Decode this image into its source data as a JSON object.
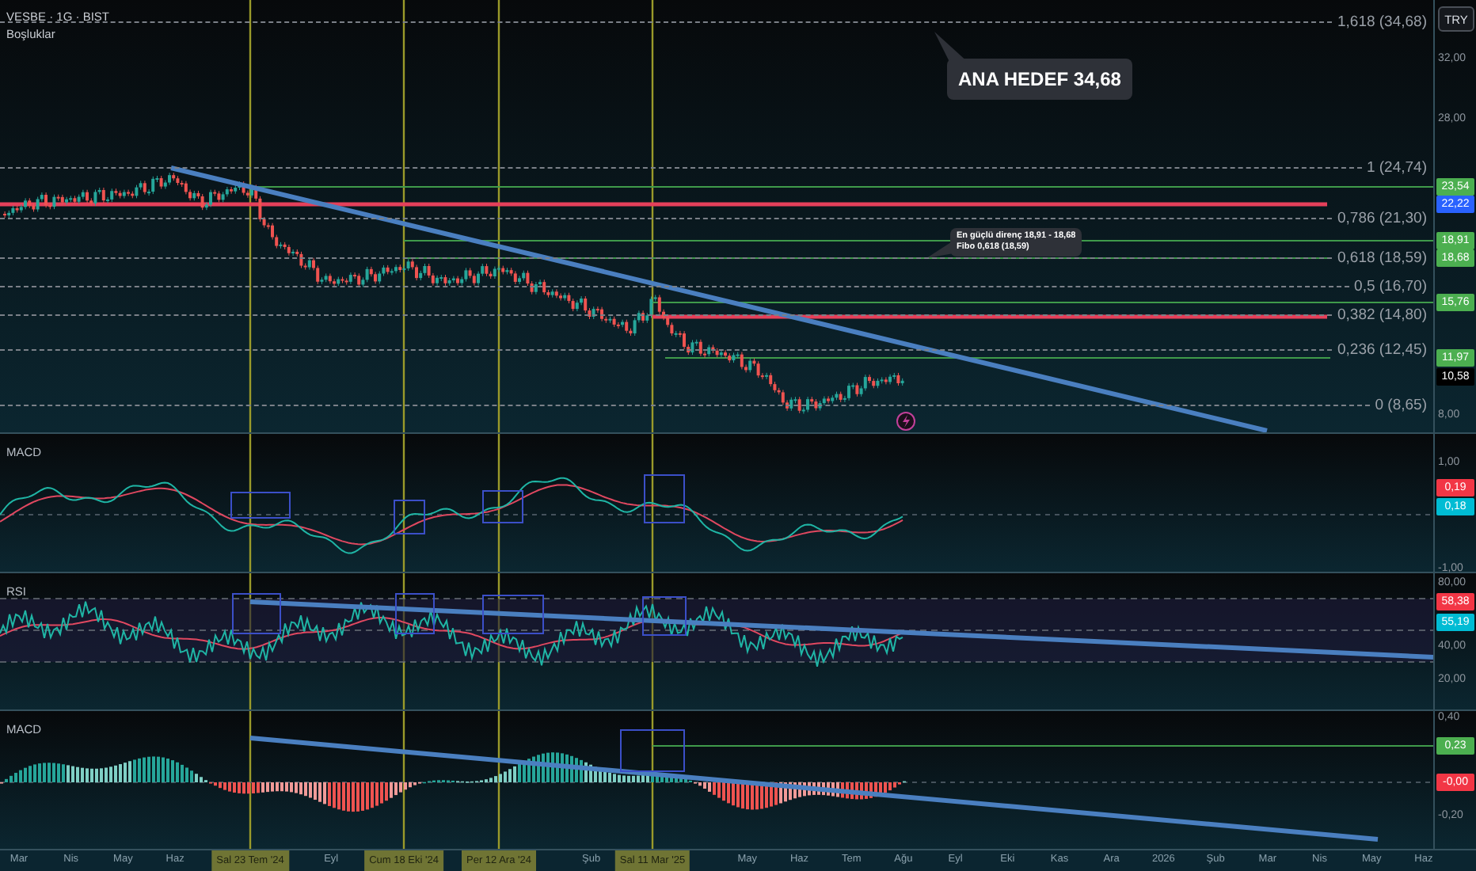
{
  "symbol": "VESBE · 1G · BIST",
  "indicator": "Boşluklar",
  "currency_button": "TRY",
  "main_pane": {
    "price_axis": [
      "32,00",
      "28,00",
      "8,00"
    ],
    "fib_levels": [
      "1,618 (34,68)",
      "1 (24,74)",
      "0,786 (21,30)",
      "0,618 (18,59)",
      "0,5 (16,70)",
      "0,382 (14,80)",
      "0,236 (12,45)",
      "0 (8,65)"
    ],
    "price_tags": [
      {
        "text": "23,54",
        "color": "#4caf50"
      },
      {
        "text": "22,22",
        "color": "#2962ff"
      },
      {
        "text": "18,91",
        "color": "#4caf50"
      },
      {
        "text": "18,68",
        "color": "#4caf50"
      },
      {
        "text": "15,76",
        "color": "#4caf50"
      },
      {
        "text": "11,97",
        "color": "#4caf50"
      },
      {
        "text": "10,58",
        "color": "#000000"
      }
    ],
    "callouts": [
      {
        "kind": "large",
        "lines": [
          "ANA HEDEF 34,68"
        ]
      },
      {
        "kind": "small",
        "lines": [
          "En güçlü direnç 18,91 - 18,68",
          "Fibo 0,618 (18,59)"
        ]
      }
    ]
  },
  "indicator_panes": [
    {
      "kind": "macd",
      "title": "MACD",
      "axis": [
        "1,00",
        "-1,00"
      ],
      "tags": [
        {
          "text": "0,19",
          "color": "#f23645"
        },
        {
          "text": "0,18",
          "color": "#00bcd4"
        }
      ]
    },
    {
      "kind": "rsi",
      "title": "RSI",
      "axis": [
        "80,00",
        "40,00",
        "20,00"
      ],
      "tags": [
        {
          "text": "58,38",
          "color": "#f23645"
        },
        {
          "text": "55,19",
          "color": "#00bcd4"
        }
      ]
    },
    {
      "kind": "histogram",
      "title": "MACD",
      "axis": [
        "0,40",
        "-0,20"
      ],
      "tags": [
        {
          "text": "0,23",
          "color": "#4caf50"
        },
        {
          "text": "-0,00",
          "color": "#f23645"
        }
      ]
    }
  ],
  "time_axis": [
    "Mar",
    "Nis",
    "May",
    "Haz",
    "Eyl",
    "Şub",
    "May",
    "Haz",
    "Tem",
    "Ağu",
    "Eyl",
    "Eki",
    "Kas",
    "Ara",
    "2026",
    "Şub",
    "Mar",
    "Nis",
    "May",
    "Haz"
  ],
  "date_markers": [
    "Sal 23 Tem '24",
    "Cum 18 Eki '24",
    "Per 12 Ara '24",
    "Sal 11 Mar '25"
  ]
}
